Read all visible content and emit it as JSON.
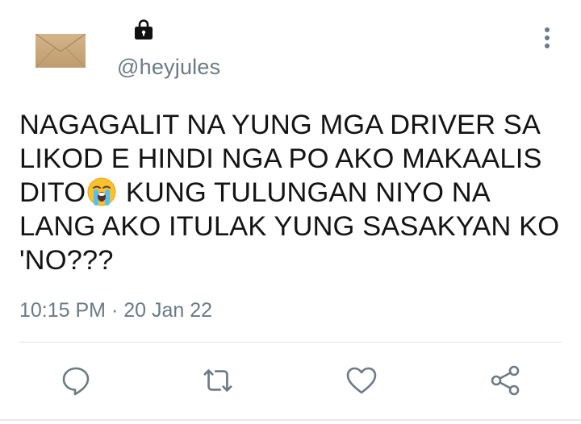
{
  "tweet": {
    "handle": "@heyjules",
    "text_part1": "NAGAGALIT NA YUNG MGA DRIVER SA\nLIKOD E HINDI NGA PO AKO MAKAALIS\nDITO",
    "text_emoji": "loudly-crying-face-emoji",
    "text_part2": " KUNG TULUNGAN NIYO NA\nLANG AKO ITULAK YUNG SASAKYAN KO\n'NO???",
    "timestamp": "10:15 PM · 20 Jan 22",
    "protected": true
  },
  "icons": {
    "avatar": "envelope-avatar",
    "lock": "lock-icon",
    "more": "more-vertical-icon",
    "reply": "reply-icon",
    "retweet": "retweet-icon",
    "like": "heart-icon",
    "share": "share-icon"
  },
  "colors": {
    "text": "#141414",
    "secondary": "#6b7a86",
    "icon": "#6b7a86",
    "divider": "#e1e4e8"
  }
}
